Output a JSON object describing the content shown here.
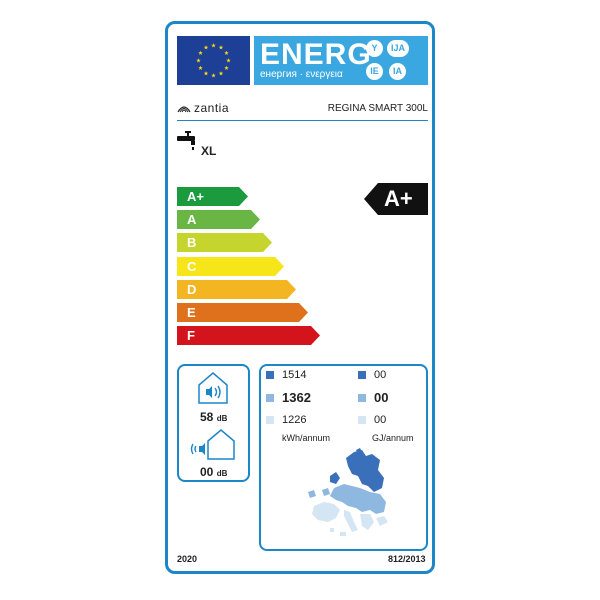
{
  "header": {
    "energ_word": "ENERG",
    "energ_sub": "енергия · ενεργεια",
    "lang_codes": [
      "Y",
      "IJA",
      "IE",
      "IA"
    ]
  },
  "supplier": {
    "brand": "zantia",
    "model": "REGINA SMART 300L"
  },
  "load_profile": "XL",
  "energy_classes": [
    {
      "label": "A+",
      "color": "#1b9a3e"
    },
    {
      "label": "A",
      "color": "#6ab645"
    },
    {
      "label": "B",
      "color": "#c6d52e"
    },
    {
      "label": "C",
      "color": "#f6e519"
    },
    {
      "label": "D",
      "color": "#f3b522"
    },
    {
      "label": "E",
      "color": "#e0711c"
    },
    {
      "label": "F",
      "color": "#d4141c"
    }
  ],
  "rating": {
    "label": "A+",
    "color": "#111111"
  },
  "noise": {
    "indoor_value": "58",
    "indoor_unit": "dB",
    "outdoor_value": "00",
    "outdoor_unit": "dB"
  },
  "consumption": {
    "electricity": [
      "1514",
      "1362",
      "1226"
    ],
    "fuel": [
      "00",
      "00",
      "00"
    ],
    "electricity_unit": "kWh/annum",
    "fuel_unit": "GJ/annum",
    "zone_colors": [
      "#3a6fb9",
      "#8fb8e0",
      "#d4e5f4"
    ]
  },
  "footer": {
    "year": "2020",
    "regulation": "812/2013"
  },
  "colors": {
    "border": "#1c86c8",
    "eu_blue": "#1d3f95",
    "energ_blue": "#3aa7e0"
  }
}
